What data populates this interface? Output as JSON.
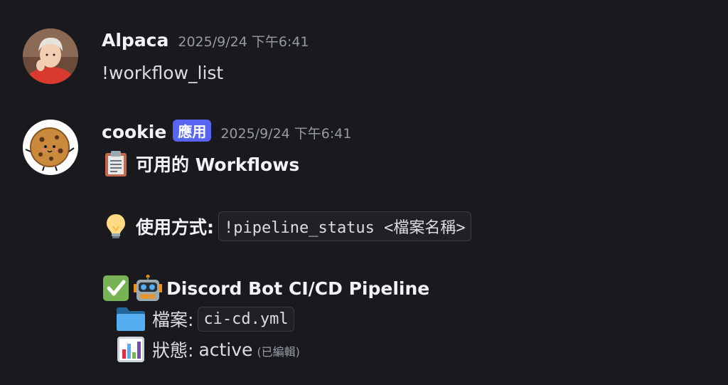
{
  "messages": [
    {
      "author": "Alpaca",
      "timestamp": "2025/9/24 下午6:41",
      "content": "!workflow_list"
    },
    {
      "author": "cookie",
      "badge": "應用",
      "timestamp": "2025/9/24 下午6:41",
      "title": "可用的 Workflows",
      "usage_label": "使用方式:",
      "usage_command": "!pipeline_status <檔案名稱>",
      "pipeline_name": "Discord Bot CI/CD Pipeline",
      "file_label": "檔案:",
      "file_value": "ci-cd.yml",
      "status_label": "狀態:",
      "status_value": "active",
      "edited_label": "(已編輯)"
    }
  ],
  "icons": {
    "title": "clipboard-icon",
    "usage": "lightbulb-icon",
    "pipeline_check": "check-mark-icon",
    "pipeline_bot": "robot-icon",
    "file": "folder-icon",
    "status": "bar-chart-icon"
  },
  "colors": {
    "background": "#1a1a1e",
    "badge": "#5865f2",
    "timestamp": "#949ba4",
    "text": "#dbdee1"
  }
}
